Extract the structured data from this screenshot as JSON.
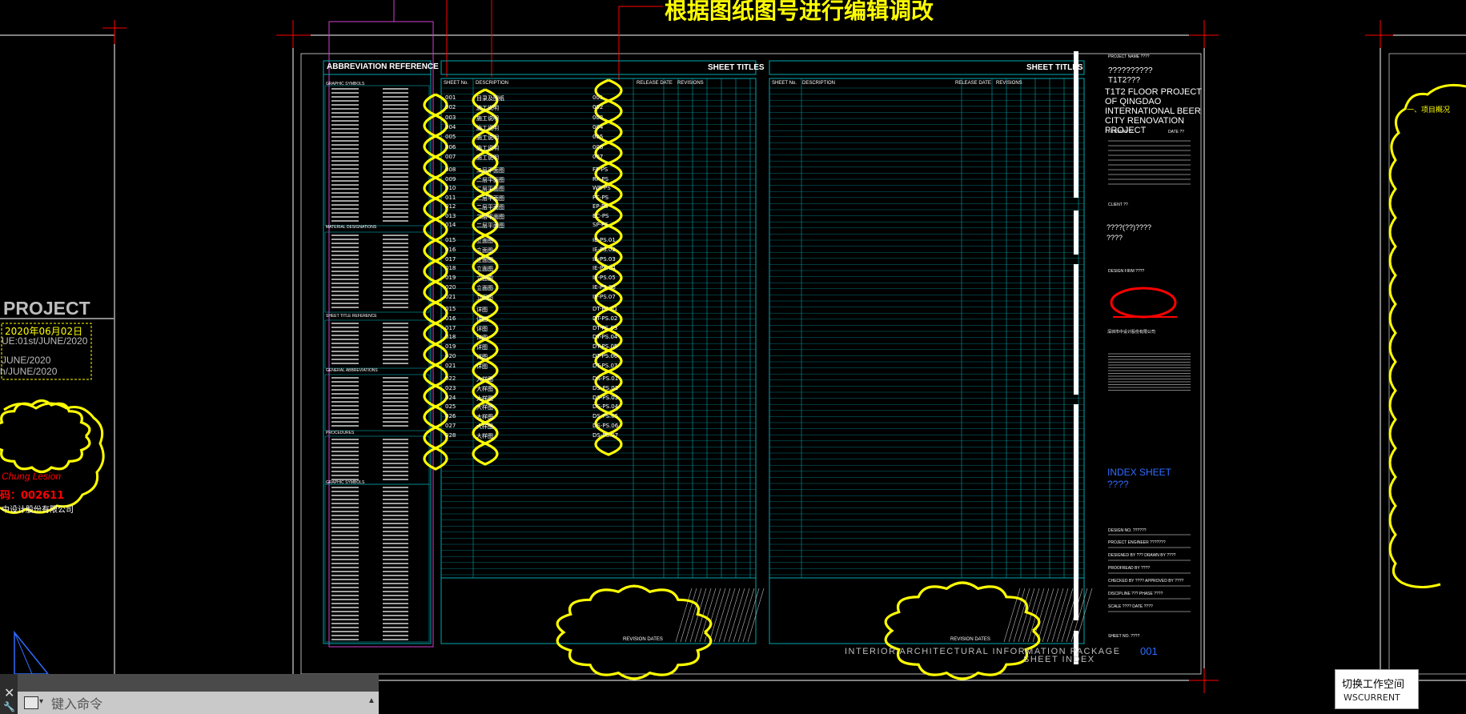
{
  "annotation": {
    "text": "根据图纸图号进行编辑调改"
  },
  "left_sheet": {
    "project": "PROJECT",
    "dates": [
      "2020年06月02日",
      "UE:01st/JUNE/2020",
      "JUNE/2020",
      "h/JUNE/2020"
    ],
    "stamp_sub": "Chung Lesion",
    "stamp_code": "码：002611",
    "company": "中设计股份有限公司"
  },
  "abbrev": {
    "title": "ABBREVIATION REFERENCE",
    "sections": [
      "GRAPHIC SYMBOLS",
      "MATERIAL DESIGNATIONS",
      "SHEET TITLE REFERENCE",
      "GENERAL ABBREVIATIONS",
      "PROCEDURES",
      "GRAPHIC SYMBOLS"
    ]
  },
  "index_table": {
    "title_left": "SHEET TITLES",
    "title_right": "SHEET TITLES",
    "headers": [
      "SHEET No.",
      "DESCRIPTION",
      "RELEASE DATE",
      "REVISIONS"
    ],
    "rows": [
      {
        "no": "001",
        "desc": "目录及图纸",
        "code": "001"
      },
      {
        "no": "002",
        "desc": "施工说明",
        "code": "002"
      },
      {
        "no": "003",
        "desc": "施工说明",
        "code": "003"
      },
      {
        "no": "004",
        "desc": "施工说明",
        "code": "004"
      },
      {
        "no": "005",
        "desc": "施工说明",
        "code": "005"
      },
      {
        "no": "006",
        "desc": "施工说明",
        "code": "006"
      },
      {
        "no": "007",
        "desc": "施工说明",
        "code": "007"
      },
      {
        "no": "008",
        "desc": "二层平面图",
        "code": "FF-PS"
      },
      {
        "no": "009",
        "desc": "二层平面图",
        "code": "RF-PS"
      },
      {
        "no": "010",
        "desc": "二层平面图",
        "code": "WR-PS"
      },
      {
        "no": "011",
        "desc": "二层平面图",
        "code": "FC-PS"
      },
      {
        "no": "012",
        "desc": "二层平面图",
        "code": "EP-PS"
      },
      {
        "no": "013",
        "desc": "二层平面图",
        "code": "EC-PS"
      },
      {
        "no": "014",
        "desc": "二层平面图",
        "code": "SP-PS"
      },
      {
        "no": "015",
        "desc": "立面图",
        "code": "IE-PS.01"
      },
      {
        "no": "016",
        "desc": "立面图",
        "code": "IE-PS.02"
      },
      {
        "no": "017",
        "desc": "立面图",
        "code": "IE-PS.03"
      },
      {
        "no": "018",
        "desc": "立面图",
        "code": "IE-PS.04"
      },
      {
        "no": "019",
        "desc": "立面图",
        "code": "IE-PS.05"
      },
      {
        "no": "020",
        "desc": "立面图",
        "code": "IE-PS.06"
      },
      {
        "no": "021",
        "desc": "立面图",
        "code": "IE-PS.07"
      },
      {
        "no": "015",
        "desc": "详图",
        "code": "DT-PS.01"
      },
      {
        "no": "016",
        "desc": "详图",
        "code": "DT-PS.02"
      },
      {
        "no": "017",
        "desc": "详图",
        "code": "DT-PS.03"
      },
      {
        "no": "018",
        "desc": "详图",
        "code": "DT-PS.04"
      },
      {
        "no": "019",
        "desc": "详图",
        "code": "DT-PS.05"
      },
      {
        "no": "020",
        "desc": "详图",
        "code": "DT-PS.06"
      },
      {
        "no": "021",
        "desc": "详图",
        "code": "DT-PS.07"
      },
      {
        "no": "022",
        "desc": "大样图",
        "code": "DS-PS.01"
      },
      {
        "no": "023",
        "desc": "大样图",
        "code": "DS-PS.02"
      },
      {
        "no": "024",
        "desc": "大样图",
        "code": "DS-PS.03"
      },
      {
        "no": "025",
        "desc": "大样图",
        "code": "DS-PS.04"
      },
      {
        "no": "026",
        "desc": "大样图",
        "code": "DS-PS.05"
      },
      {
        "no": "027",
        "desc": "大样图",
        "code": "DS-PS.06"
      },
      {
        "no": "028",
        "desc": "大样图",
        "code": "DS-PS.07"
      }
    ],
    "revision_label": "REVISION DATES",
    "package_title": "INTERIOR ARCHITECTURAL INFORMATION PACKAGE",
    "sheet_index": "SHEET INDEX"
  },
  "title_block": {
    "project_name_label": "PROJECT NAME ????",
    "project_cn": "??????????",
    "project_cn2": "T1T2???",
    "project_en": [
      "T1T2 FLOOR PROJECT",
      "OF QINGDAO",
      "INTERNATIONAL BEER",
      "CITY RENOVATION",
      "PROJECT"
    ],
    "revision_label": "REVISION ??",
    "date_label": "DATE ??",
    "client_label": "CLIENT ??",
    "client_name": "????(??)????",
    "client_name2": "????",
    "design_firm_label": "DESIGN FIRM ????",
    "firm_name": "深圳市中设计股份有限公司",
    "sheet_title_en": "INDEX SHEET",
    "sheet_title_cn": "????",
    "fields": [
      "DESIGN NO. ??????",
      "PROJECT ENGINEER ???????",
      "DESIGNED BY ???      DRAWN BY ????",
      "PROOFREAD BY ????",
      "CHECKED BY ????      APPROVED BY ????",
      "DISCIPLINE ???       PHASE ????",
      "SCALE ????           DATE ????"
    ],
    "sheet_no_label": "SHEET NO. ????",
    "sheet_no": "001"
  },
  "right_sheet": {
    "heading": "一、项目概况"
  },
  "command_line": {
    "placeholder": "键入命令"
  },
  "tooltip": {
    "title": "切换工作空间",
    "command": "WSCURRENT"
  },
  "colors": {
    "background": "#000000",
    "cyan": "#00a8b0",
    "yellow": "#ffff00",
    "red": "#ff0000",
    "magenta": "#d040d0",
    "white": "#ffffff",
    "blue": "#2f6cff"
  }
}
